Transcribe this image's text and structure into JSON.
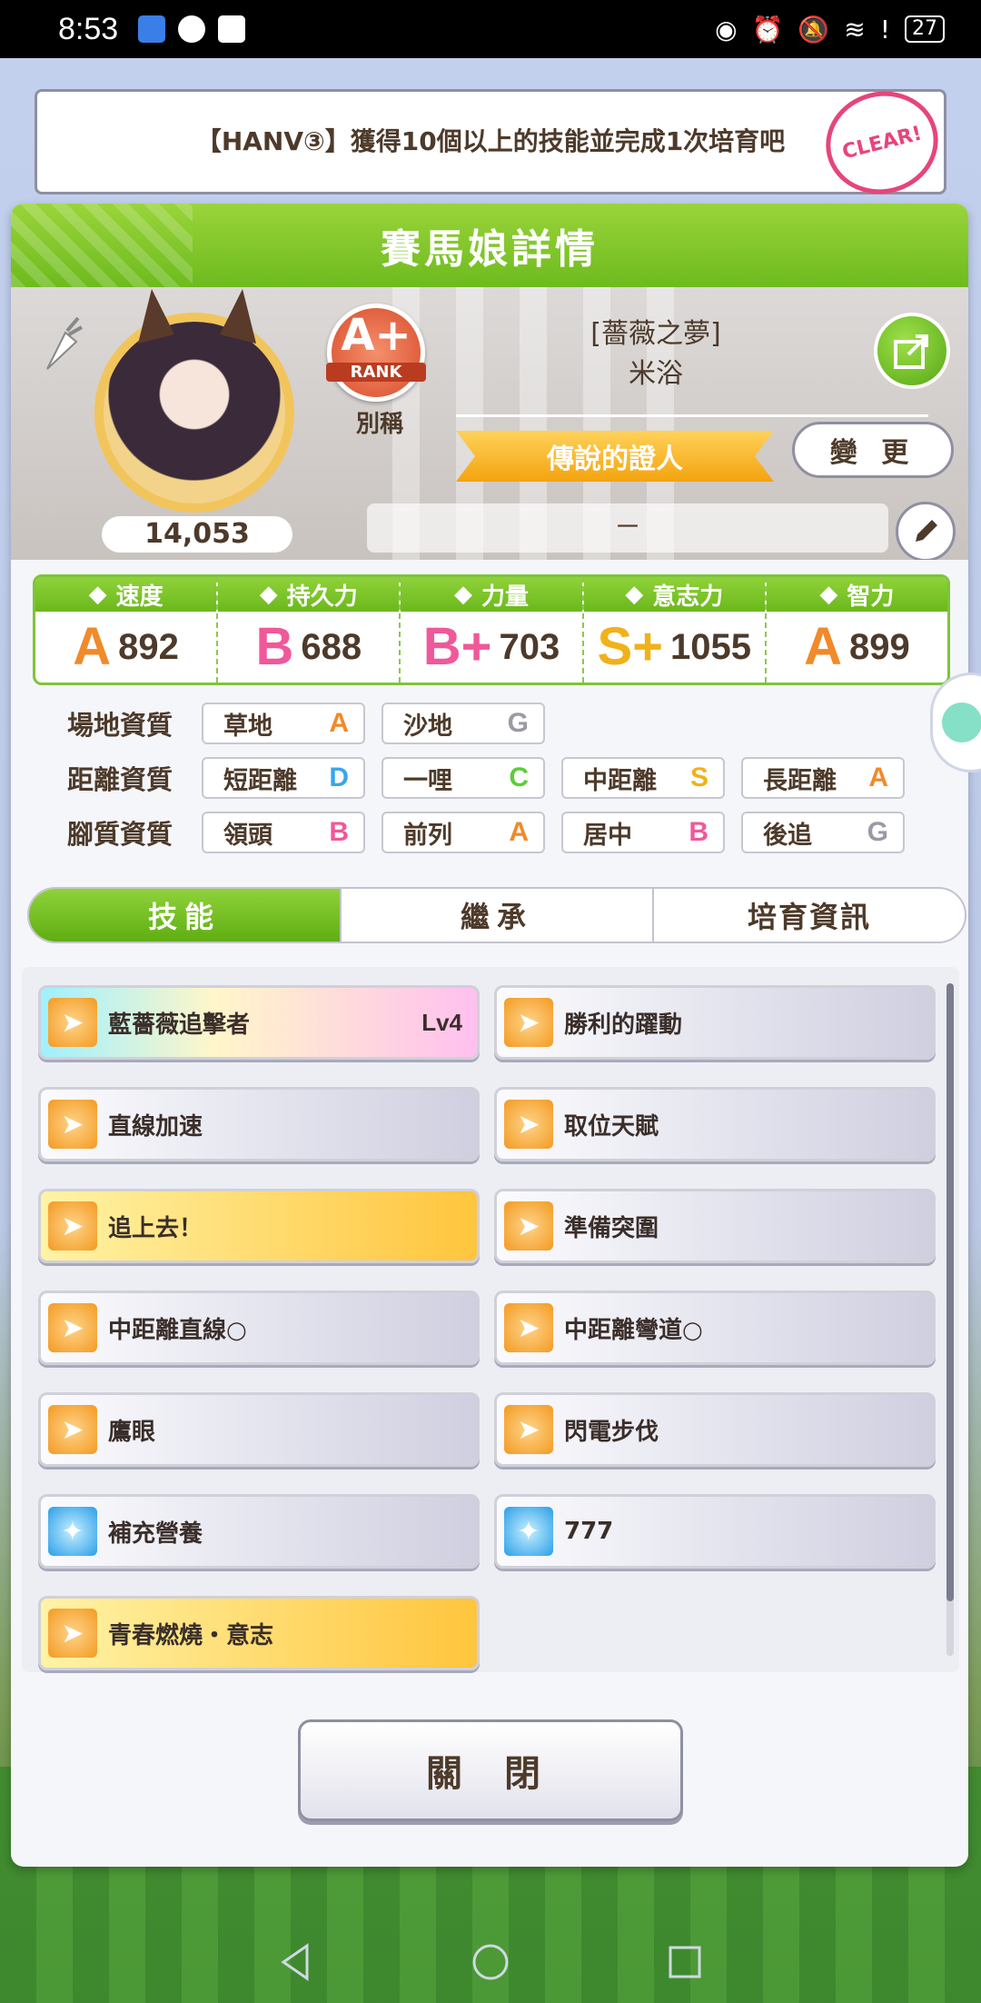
{
  "status_bar": {
    "time": "8:53",
    "battery": "27",
    "notification_icons": [
      "app-icon",
      "wechat-icon",
      "huawei-icon"
    ],
    "system_icons": [
      "eye-icon",
      "alarm-icon",
      "mute-icon",
      "wifi-icon",
      "alert-icon"
    ]
  },
  "mission": {
    "text": "【HANV③】獲得10個以上的技能並完成1次培育吧",
    "stamp": "CLEAR!"
  },
  "panel": {
    "title": "賽馬娘詳情"
  },
  "profile": {
    "fans": "14,053",
    "rank_grade": "A+",
    "rank_label": "RANK",
    "nickname_label": "別稱",
    "title_line1": "[薔薇之夢]",
    "title_line2": "米浴",
    "alias": "傳說的證人",
    "change_label": "變 更",
    "comment": "－"
  },
  "stats": [
    {
      "name": "速度",
      "grade": "A",
      "value": "892",
      "icon": "shoe-icon",
      "color": "#f08a2a"
    },
    {
      "name": "持久力",
      "grade": "B",
      "value": "688",
      "icon": "heart-icon",
      "color": "#f0589a"
    },
    {
      "name": "力量",
      "grade": "B+",
      "value": "703",
      "icon": "muscle-icon",
      "color": "#f0589a"
    },
    {
      "name": "意志力",
      "grade": "S+",
      "value": "1055",
      "icon": "flame-icon",
      "color": "#f0b21a"
    },
    {
      "name": "智力",
      "grade": "A",
      "value": "899",
      "icon": "graduation-cap-icon",
      "color": "#f08a2a"
    }
  ],
  "aptitude": {
    "track": {
      "label": "場地資質",
      "items": [
        {
          "name": "草地",
          "grade": "A"
        },
        {
          "name": "沙地",
          "grade": "G"
        }
      ]
    },
    "distance": {
      "label": "距離資質",
      "items": [
        {
          "name": "短距離",
          "grade": "D"
        },
        {
          "name": "一哩",
          "grade": "C"
        },
        {
          "name": "中距離",
          "grade": "S"
        },
        {
          "name": "長距離",
          "grade": "A"
        }
      ]
    },
    "style": {
      "label": "腳質資質",
      "items": [
        {
          "name": "領頭",
          "grade": "B"
        },
        {
          "name": "前列",
          "grade": "A"
        },
        {
          "name": "居中",
          "grade": "B"
        },
        {
          "name": "後追",
          "grade": "G"
        }
      ]
    }
  },
  "grade_colors": {
    "S": "#f0b21a",
    "A": "#f08a2a",
    "B": "#f0589a",
    "C": "#5ccd3a",
    "D": "#3aa6ea",
    "G": "#9a9aa6"
  },
  "tabs": [
    "技能",
    "繼承",
    "培育資訊"
  ],
  "active_tab": 0,
  "skills": [
    {
      "name": "藍薔薇追擊者",
      "level": "Lv4",
      "style": "rainbow",
      "icon": "orange"
    },
    {
      "name": "勝利的躍動",
      "level": "",
      "style": "normal",
      "icon": "orange"
    },
    {
      "name": "直線加速",
      "level": "",
      "style": "normal",
      "icon": "orange"
    },
    {
      "name": "取位天賦",
      "level": "",
      "style": "normal",
      "icon": "orange"
    },
    {
      "name": "追上去！",
      "level": "",
      "style": "gold",
      "icon": "orange"
    },
    {
      "name": "準備突圍",
      "level": "",
      "style": "normal",
      "icon": "orange"
    },
    {
      "name": "中距離直線○",
      "level": "",
      "style": "normal",
      "icon": "orange"
    },
    {
      "name": "中距離彎道○",
      "level": "",
      "style": "normal",
      "icon": "orange"
    },
    {
      "name": "鷹眼",
      "level": "",
      "style": "normal",
      "icon": "orange"
    },
    {
      "name": "閃電步伐",
      "level": "",
      "style": "normal",
      "icon": "orange"
    },
    {
      "name": "補充營養",
      "level": "",
      "style": "normal",
      "icon": "blue"
    },
    {
      "name": "777",
      "level": "",
      "style": "normal",
      "icon": "blue"
    },
    {
      "name": "青春燃燒・意志",
      "level": "",
      "style": "gold",
      "icon": "orange"
    }
  ],
  "close_label": "關 閉"
}
